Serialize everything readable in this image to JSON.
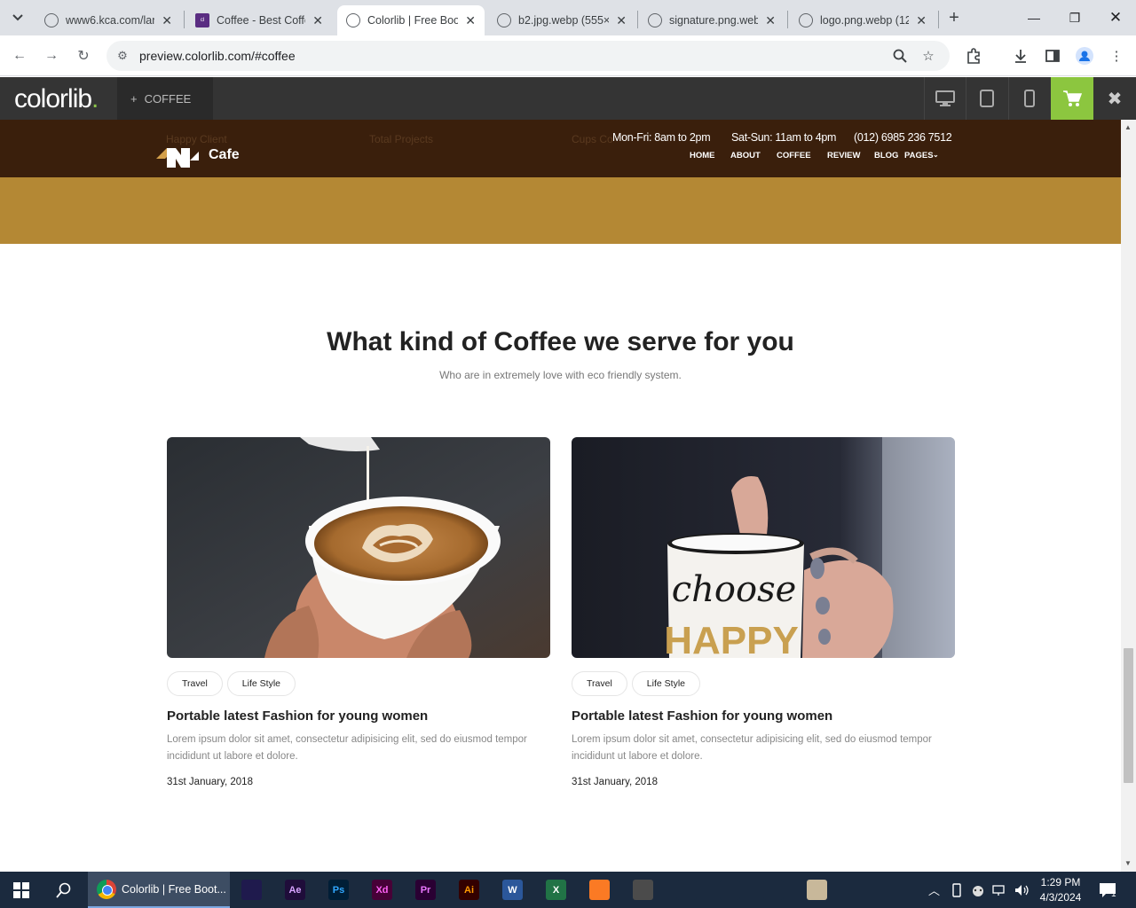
{
  "browser": {
    "tabs": [
      {
        "title": "www6.kca.com/lan",
        "favicon": "globe-icon",
        "active": false
      },
      {
        "title": "Coffee - Best Coffe",
        "favicon": "colorlib-favicon",
        "active": false
      },
      {
        "title": "Colorlib | Free Boo",
        "favicon": "globe-icon",
        "active": true
      },
      {
        "title": "b2.jpg.webp (555×",
        "favicon": "globe-icon",
        "active": false
      },
      {
        "title": "signature.png.web",
        "favicon": "globe-icon",
        "active": false
      },
      {
        "title": "logo.png.webp (12",
        "favicon": "globe-icon",
        "active": false
      }
    ],
    "url": "preview.colorlib.com/#coffee"
  },
  "colorlib_bar": {
    "logo": "colorlib",
    "logo_dot": ".",
    "theme_label": "COFFEE",
    "accent": "#8cc63f"
  },
  "site": {
    "ghost_stats": [
      "Happy Client",
      "Total Projects",
      "Cups Co"
    ],
    "brand_name": "Cafe",
    "hours_weekday": "Mon-Fri: 8am to 2pm",
    "hours_weekend": "Sat-Sun: 11am to 4pm",
    "phone": "(012) 6985 236 7512",
    "menu": [
      "HOME",
      "ABOUT",
      "COFFEE",
      "REVIEW",
      "BLOG",
      "PAGES"
    ],
    "header_color": "#3a1f0c",
    "band_color": "#b48834"
  },
  "section": {
    "title": "What kind of Coffee we serve for you",
    "subtitle": "Who are in extremely love with eco friendly system."
  },
  "cards": [
    {
      "image": "latte-art-cup-photo",
      "tags": [
        "Travel",
        "Life Style"
      ],
      "title": "Portable latest Fashion for young women",
      "text": "Lorem ipsum dolor sit amet, consectetur adipisicing elit, sed do eiusmod tempor incididunt ut labore et dolore.",
      "date": "31st January, 2018"
    },
    {
      "image": "choose-happy-mug-photo",
      "mug_text_top": "choose",
      "mug_text_bottom": "HAPPY",
      "tags": [
        "Travel",
        "Life Style"
      ],
      "title": "Portable latest Fashion for young women",
      "text": "Lorem ipsum dolor sit amet, consectetur adipisicing elit, sed do eiusmod tempor incididunt ut labore et dolore.",
      "date": "31st January, 2018"
    }
  ],
  "taskbar": {
    "active_app": "Colorlib | Free Boot...",
    "apps": [
      {
        "label": "",
        "name": "adobe-media-encoder-icon",
        "bg": "#1f1a4d",
        "fg": "#9b8cff"
      },
      {
        "label": "Ae",
        "name": "after-effects-icon",
        "bg": "#1f0d3a",
        "fg": "#d7a3ff"
      },
      {
        "label": "Ps",
        "name": "photoshop-icon",
        "bg": "#001e36",
        "fg": "#31a8ff"
      },
      {
        "label": "Xd",
        "name": "xd-icon",
        "bg": "#470137",
        "fg": "#ff61f6"
      },
      {
        "label": "Pr",
        "name": "premiere-icon",
        "bg": "#2a0033",
        "fg": "#ea77ff"
      },
      {
        "label": "Ai",
        "name": "illustrator-icon",
        "bg": "#330000",
        "fg": "#ff9a00"
      },
      {
        "label": "W",
        "name": "word-icon",
        "bg": "#2b579a",
        "fg": "#ffffff"
      },
      {
        "label": "X",
        "name": "excel-icon",
        "bg": "#217346",
        "fg": "#ffffff"
      },
      {
        "label": "",
        "name": "xampp-icon",
        "bg": "#fb7a24",
        "fg": "#ffffff"
      },
      {
        "label": "",
        "name": "sublime-icon",
        "bg": "#4b4b4b",
        "fg": "#ff9800"
      },
      {
        "label": "",
        "name": "figma-icon",
        "bg": "#1b2a3e",
        "fg": "#ffffff"
      },
      {
        "label": "",
        "name": "vscode-icon",
        "bg": "#1b2a3e",
        "fg": "#23a9f2"
      },
      {
        "label": "",
        "name": "paint-icon",
        "bg": "#1b2a3e",
        "fg": "#ff6b9a"
      },
      {
        "label": "",
        "name": "photo-thumbnail-icon",
        "bg": "#c8b89a",
        "fg": "#333333"
      }
    ],
    "time": "1:29 PM",
    "date": "4/3/2024",
    "notification_count": "1"
  }
}
